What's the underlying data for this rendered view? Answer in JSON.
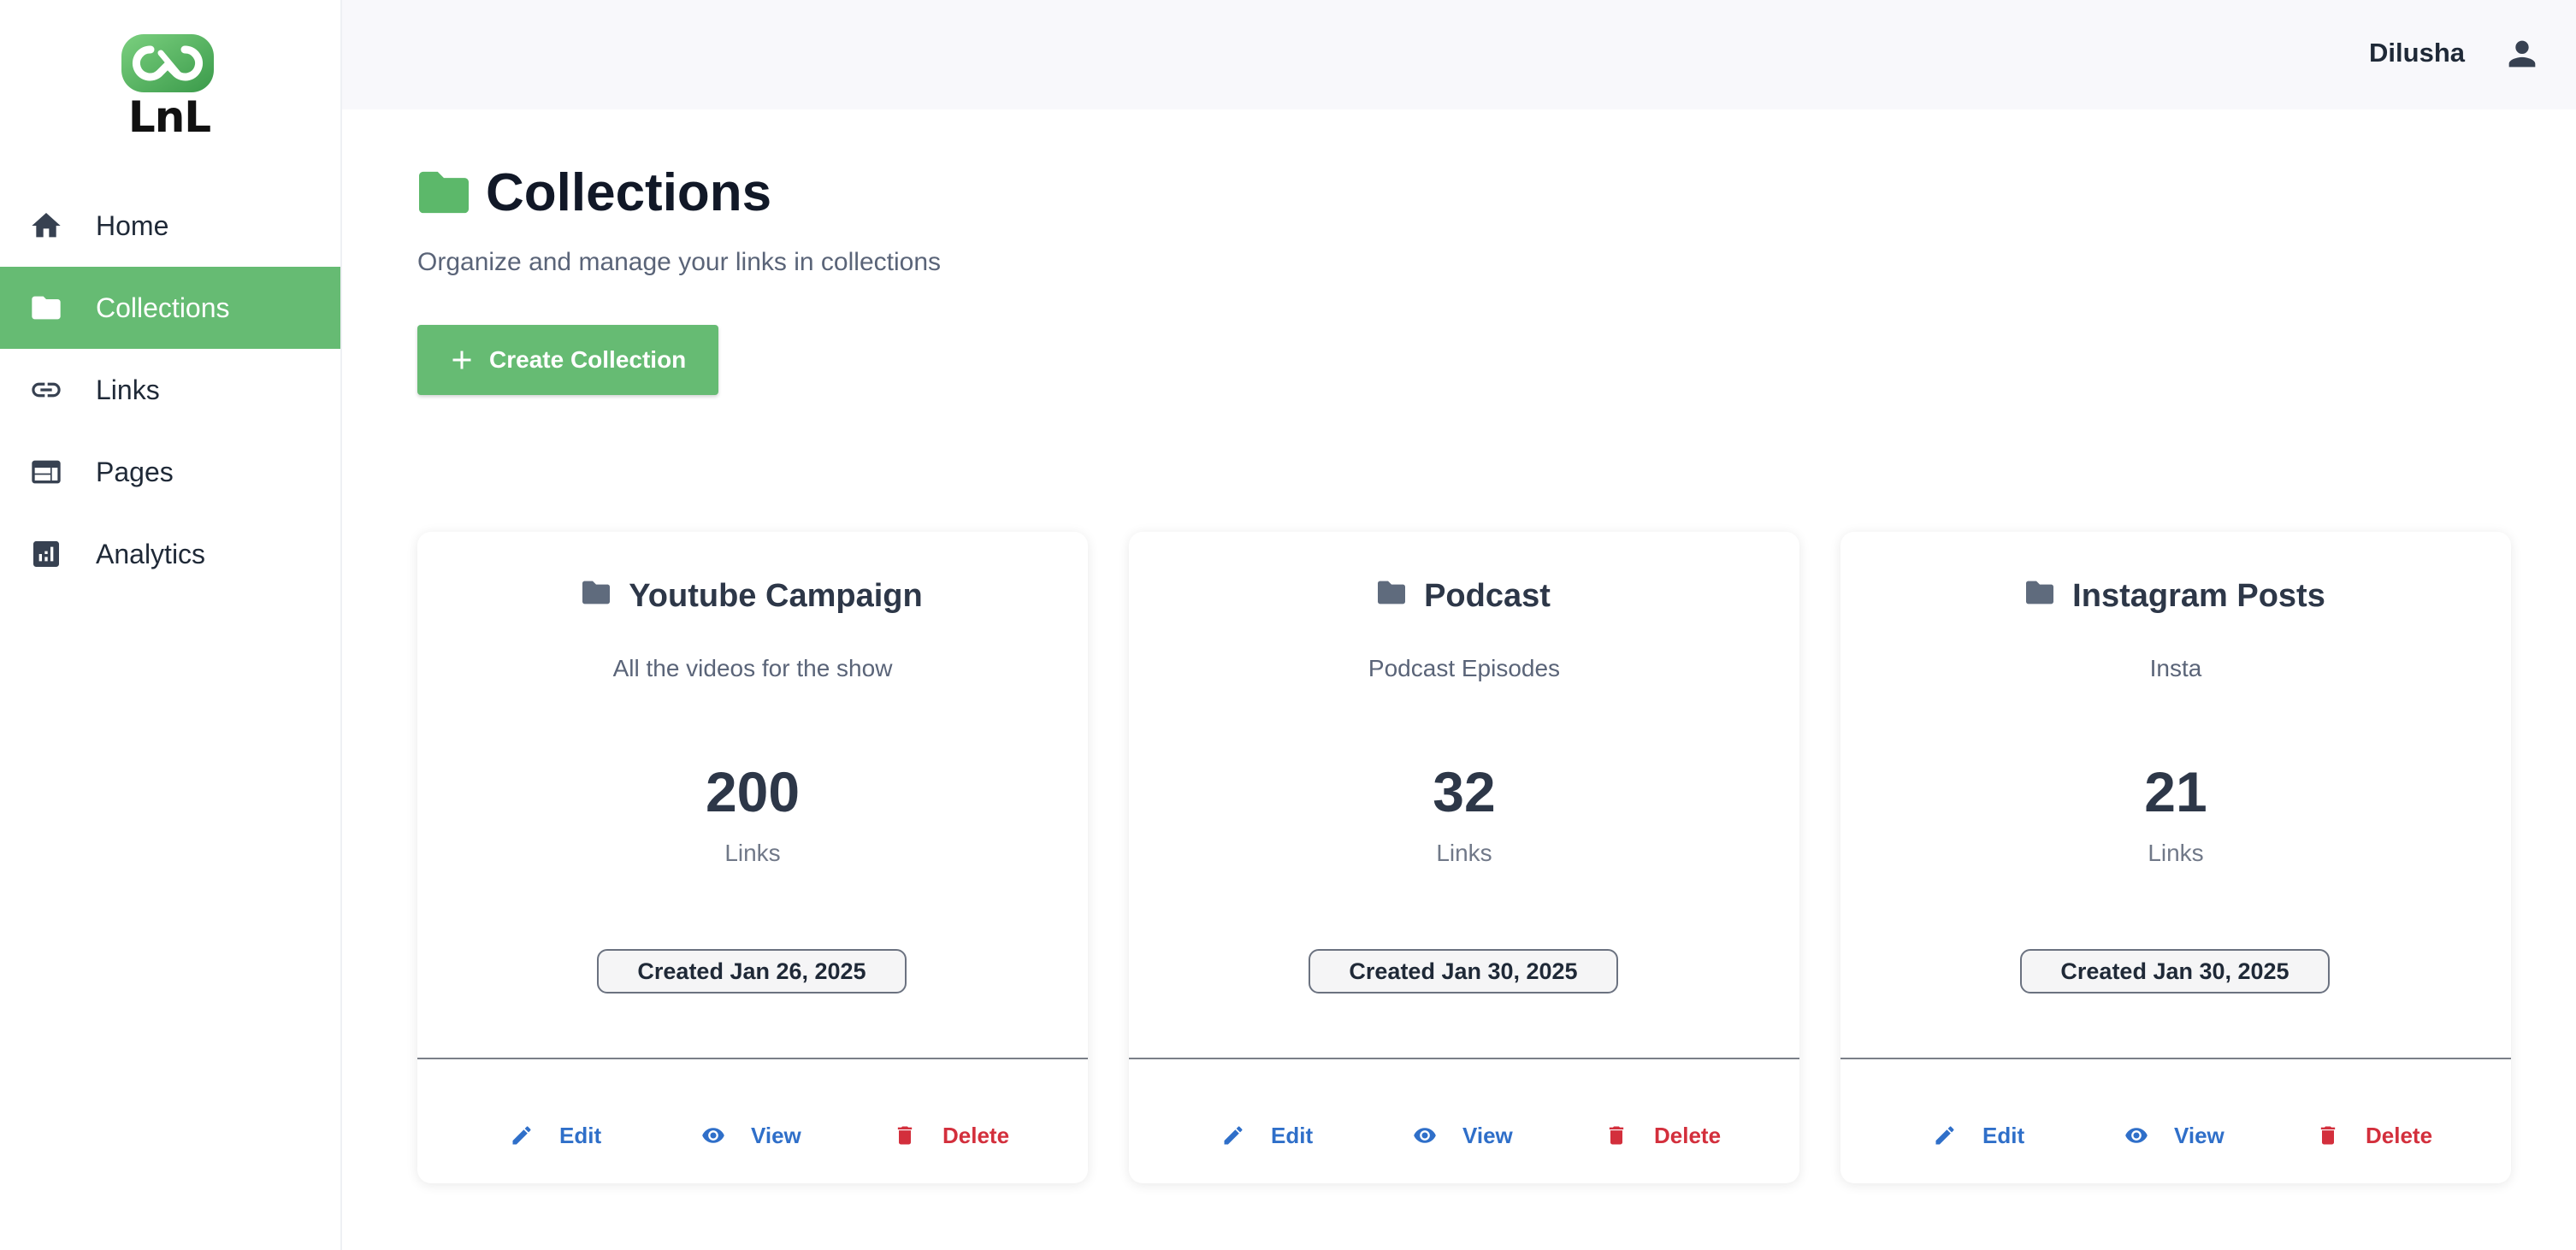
{
  "app": {
    "logo_text": "LnL",
    "accent_color": "#66bb73"
  },
  "sidebar": {
    "items": [
      {
        "label": "Home",
        "icon": "home-icon",
        "active": false
      },
      {
        "label": "Collections",
        "icon": "folder-icon",
        "active": true
      },
      {
        "label": "Links",
        "icon": "link-icon",
        "active": false
      },
      {
        "label": "Pages",
        "icon": "web-page-icon",
        "active": false
      },
      {
        "label": "Analytics",
        "icon": "analytics-icon",
        "active": false
      }
    ]
  },
  "header": {
    "username": "Dilusha",
    "user_icon": "person-icon"
  },
  "main": {
    "title": "Collections",
    "subtitle": "Organize and manage your links in collections",
    "create_button": "Create Collection"
  },
  "collections": [
    {
      "title": "Youtube Campaign",
      "description": "All the videos for the show",
      "count": "200",
      "unit": "Links",
      "created": "Created Jan 26, 2025",
      "edit": "Edit",
      "view": "View",
      "delete": "Delete"
    },
    {
      "title": "Podcast",
      "description": "Podcast Episodes",
      "count": "32",
      "unit": "Links",
      "created": "Created Jan 30, 2025",
      "edit": "Edit",
      "view": "View",
      "delete": "Delete"
    },
    {
      "title": "Instagram Posts",
      "description": "Insta",
      "count": "21",
      "unit": "Links",
      "created": "Created Jan 30, 2025",
      "edit": "Edit",
      "view": "View",
      "delete": "Delete"
    }
  ],
  "colors": {
    "link_blue": "#2f6fc9",
    "danger_red": "#d32f3c",
    "title_dark": "#2d3748"
  }
}
